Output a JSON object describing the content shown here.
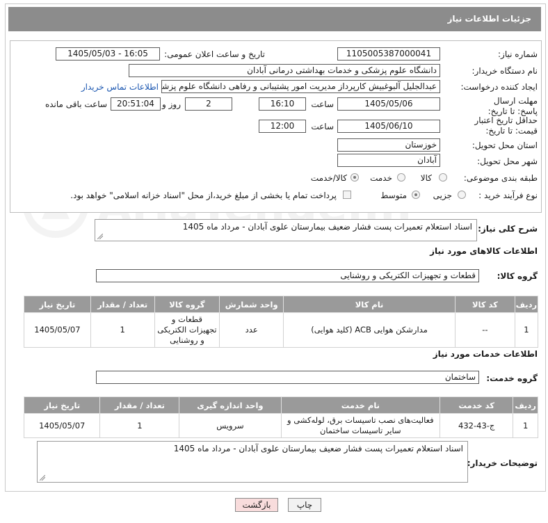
{
  "header": {
    "title": "جزئیات اطلاعات نیاز"
  },
  "fields": {
    "need_number_label": "شماره نیاز:",
    "need_number": "1105005387000041",
    "announce_label": "تاریخ و ساعت اعلان عمومی:",
    "announce_value": "1405/05/03 - 16:05",
    "buyer_org_label": "نام دستگاه خریدار:",
    "buyer_org": "دانشگاه علوم پزشکی و خدمات بهداشتی  درمانی آبادان",
    "requester_label": "ایجاد کننده درخواست:",
    "requester": "عبدالجلیل آلبوغبیش کارپرداز مدیریت امور پشتیبانی و رفاهی دانشگاه علوم پزشکی",
    "contact_link": "اطلاعات تماس خریدار",
    "reply_deadline_label": "مهلت ارسال پاسخ: تا تاریخ:",
    "reply_date": "1405/05/06",
    "time_label": "ساعت",
    "reply_time": "16:10",
    "days_value": "2",
    "days_label": "روز و",
    "remaining_time": "20:51:04",
    "remaining_label": "ساعت باقی مانده",
    "price_validity_label": "حداقل تاریخ اعتبار قیمت: تا تاریخ:",
    "price_date": "1405/06/10",
    "price_time": "12:00",
    "province_label": "استان محل تحویل:",
    "province": "خوزستان",
    "city_label": "شهر محل تحویل:",
    "city": "آبادان",
    "category_label": "طبقه بندی موضوعی:",
    "category_options": [
      "کالا",
      "خدمت",
      "کالا/خدمت"
    ],
    "process_label": "نوع فرآیند خرید :",
    "process_options": [
      "جزیی",
      "متوسط"
    ],
    "payment_note": "پرداخت تمام یا بخشی از مبلغ خرید،از محل \"اسناد خزانه اسلامی\" خواهد بود."
  },
  "summary": {
    "label": "شرح کلی نیاز:",
    "text": "اسناد استعلام تعمیرات پست فشار ضعیف بیمارستان علوی آبادان - مرداد ماه 1405"
  },
  "goods": {
    "section_title": "اطلاعات کالاهای مورد نیاز",
    "group_label": "گروه کالا:",
    "group_value": "قطعات و تجهیزات الکتریکی و روشنایی",
    "columns": [
      "ردیف",
      "کد کالا",
      "نام کالا",
      "واحد شمارش",
      "گروه کالا",
      "تعداد / مقدار",
      "تاریخ نیاز"
    ],
    "rows": [
      {
        "row": "1",
        "code": "--",
        "name": "مدارشکن هوایی ACB (کلید هوایی)",
        "unit": "عدد",
        "group": "قطعات و تجهیزات الکتریکی و روشنایی",
        "qty": "1",
        "date": "1405/05/07"
      }
    ]
  },
  "services": {
    "section_title": "اطلاعات خدمات مورد نیاز",
    "group_label": "گروه خدمت:",
    "group_value": "ساختمان",
    "columns": [
      "ردیف",
      "کد خدمت",
      "نام خدمت",
      "واحد اندازه گیری",
      "تعداد / مقدار",
      "تاریخ نیاز"
    ],
    "rows": [
      {
        "row": "1",
        "code": "ج-43-432",
        "name": "فعالیت‌های نصب تاسیسات برق، لوله‌کشی و سایر تاسیسات ساختمان",
        "unit": "سرویس",
        "qty": "1",
        "date": "1405/05/07"
      }
    ]
  },
  "buyer_notes": {
    "label": "توضیحات خریدار:",
    "text": "اسناد استعلام تعمیرات پست فشار ضعیف بیمارستان علوی آبادان - مرداد ماه 1405"
  },
  "buttons": {
    "print": "چاپ",
    "back": "بازگشت"
  },
  "watermark": {
    "text": "AriaTender.neT"
  },
  "colors": {
    "header": "#8c8c8c",
    "table_header": "#9a9a9a",
    "back_button": "#f8dcdc",
    "link": "#1a56b0"
  }
}
